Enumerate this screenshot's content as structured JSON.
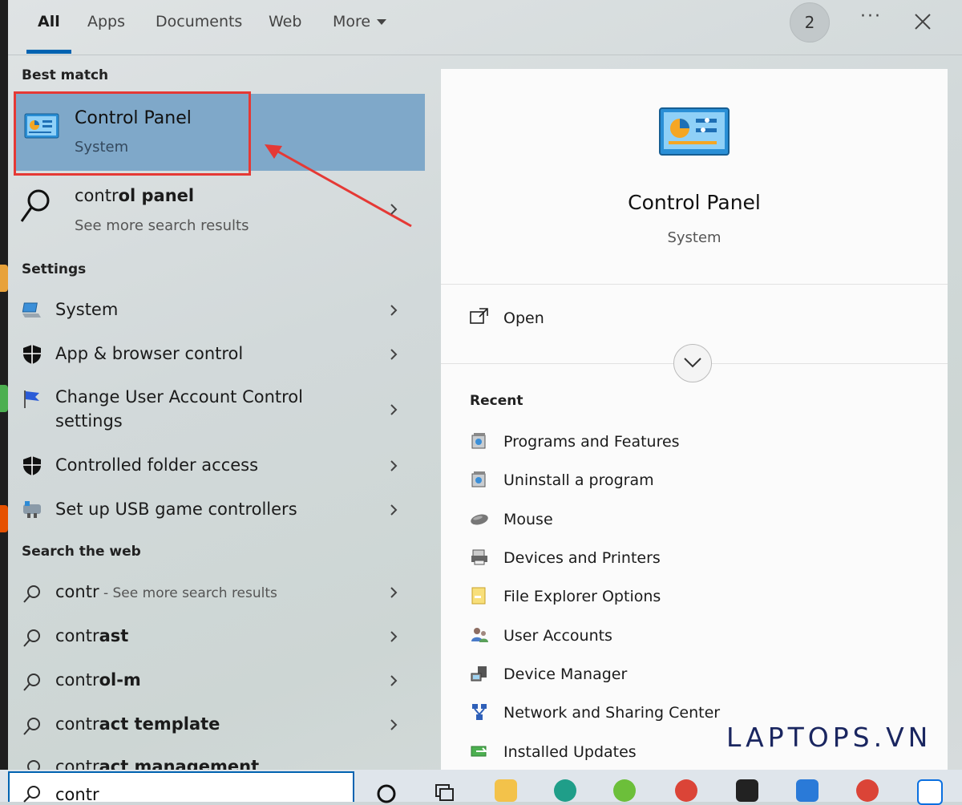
{
  "tabs": {
    "all": "All",
    "apps": "Apps",
    "documents": "Documents",
    "web": "Web",
    "more": "More"
  },
  "header": {
    "badge_count": "2",
    "more_dots": "···"
  },
  "sections": {
    "best_match": "Best match",
    "settings": "Settings",
    "search_web": "Search the web"
  },
  "best_match": {
    "title": "Control Panel",
    "subtitle": "System"
  },
  "more_results": {
    "prefix": "contr",
    "bold": "ol panel",
    "subtitle": "See more search results"
  },
  "settings_items": [
    {
      "label": "System"
    },
    {
      "label": "App & browser control"
    },
    {
      "label_line1": "Change User Account Control",
      "label_line2": "settings"
    },
    {
      "label": "Controlled folder access"
    },
    {
      "label": "Set up USB game controllers"
    }
  ],
  "web_items": [
    {
      "prefix": "contr",
      "suffix": " - See more search results"
    },
    {
      "prefix": "contr",
      "bold": "ast"
    },
    {
      "prefix": "contr",
      "bold": "ol-m"
    },
    {
      "prefix": "contr",
      "bold": "act template"
    },
    {
      "prefix": "contr",
      "bold": "act management"
    }
  ],
  "preview": {
    "title": "Control Panel",
    "subtitle": "System",
    "open_label": "Open",
    "recent_heading": "Recent"
  },
  "recent_items": [
    {
      "label": "Programs and Features",
      "icon": "programs-icon"
    },
    {
      "label": "Uninstall a program",
      "icon": "uninstall-icon"
    },
    {
      "label": "Mouse",
      "icon": "mouse-icon"
    },
    {
      "label": "Devices and Printers",
      "icon": "printer-icon"
    },
    {
      "label": "File Explorer Options",
      "icon": "folder-options-icon"
    },
    {
      "label": "User Accounts",
      "icon": "user-accounts-icon"
    },
    {
      "label": "Device Manager",
      "icon": "device-manager-icon"
    },
    {
      "label": "Network and Sharing Center",
      "icon": "network-icon"
    },
    {
      "label": "Installed Updates",
      "icon": "updates-icon"
    }
  ],
  "search": {
    "value": "contr"
  },
  "watermark": "LAPTOPS.VN",
  "colors": {
    "accent": "#0063b1",
    "selection": "#7fa8c9",
    "annotation": "#e53935"
  }
}
